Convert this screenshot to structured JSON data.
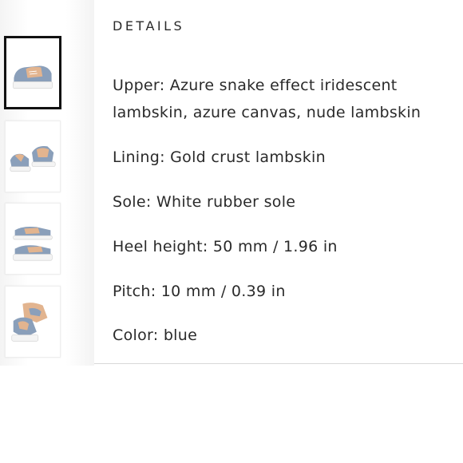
{
  "details": {
    "heading": "DETAILS",
    "specs": [
      "Upper: Azure snake effect iridescent lambskin, azure canvas, nude lambskin",
      "Lining: Gold crust lambskin",
      "Sole: White rubber sole",
      "Heel height: 50 mm / 1.96 in",
      "Pitch: 10 mm / 0.39 in",
      "Color: blue"
    ]
  },
  "thumbnails": {
    "selected_index": 0,
    "items": [
      {
        "icon": "sneaker-pair-front-thumbnail"
      },
      {
        "icon": "sneaker-pair-side-thumbnail"
      },
      {
        "icon": "sneaker-pair-top-thumbnail"
      },
      {
        "icon": "sneaker-pair-angle-thumbnail"
      }
    ]
  },
  "colors": {
    "azure": "#8a9fba",
    "nude": "#e2b48f",
    "sole": "#f4f4f4",
    "selected_border": "#111111"
  }
}
